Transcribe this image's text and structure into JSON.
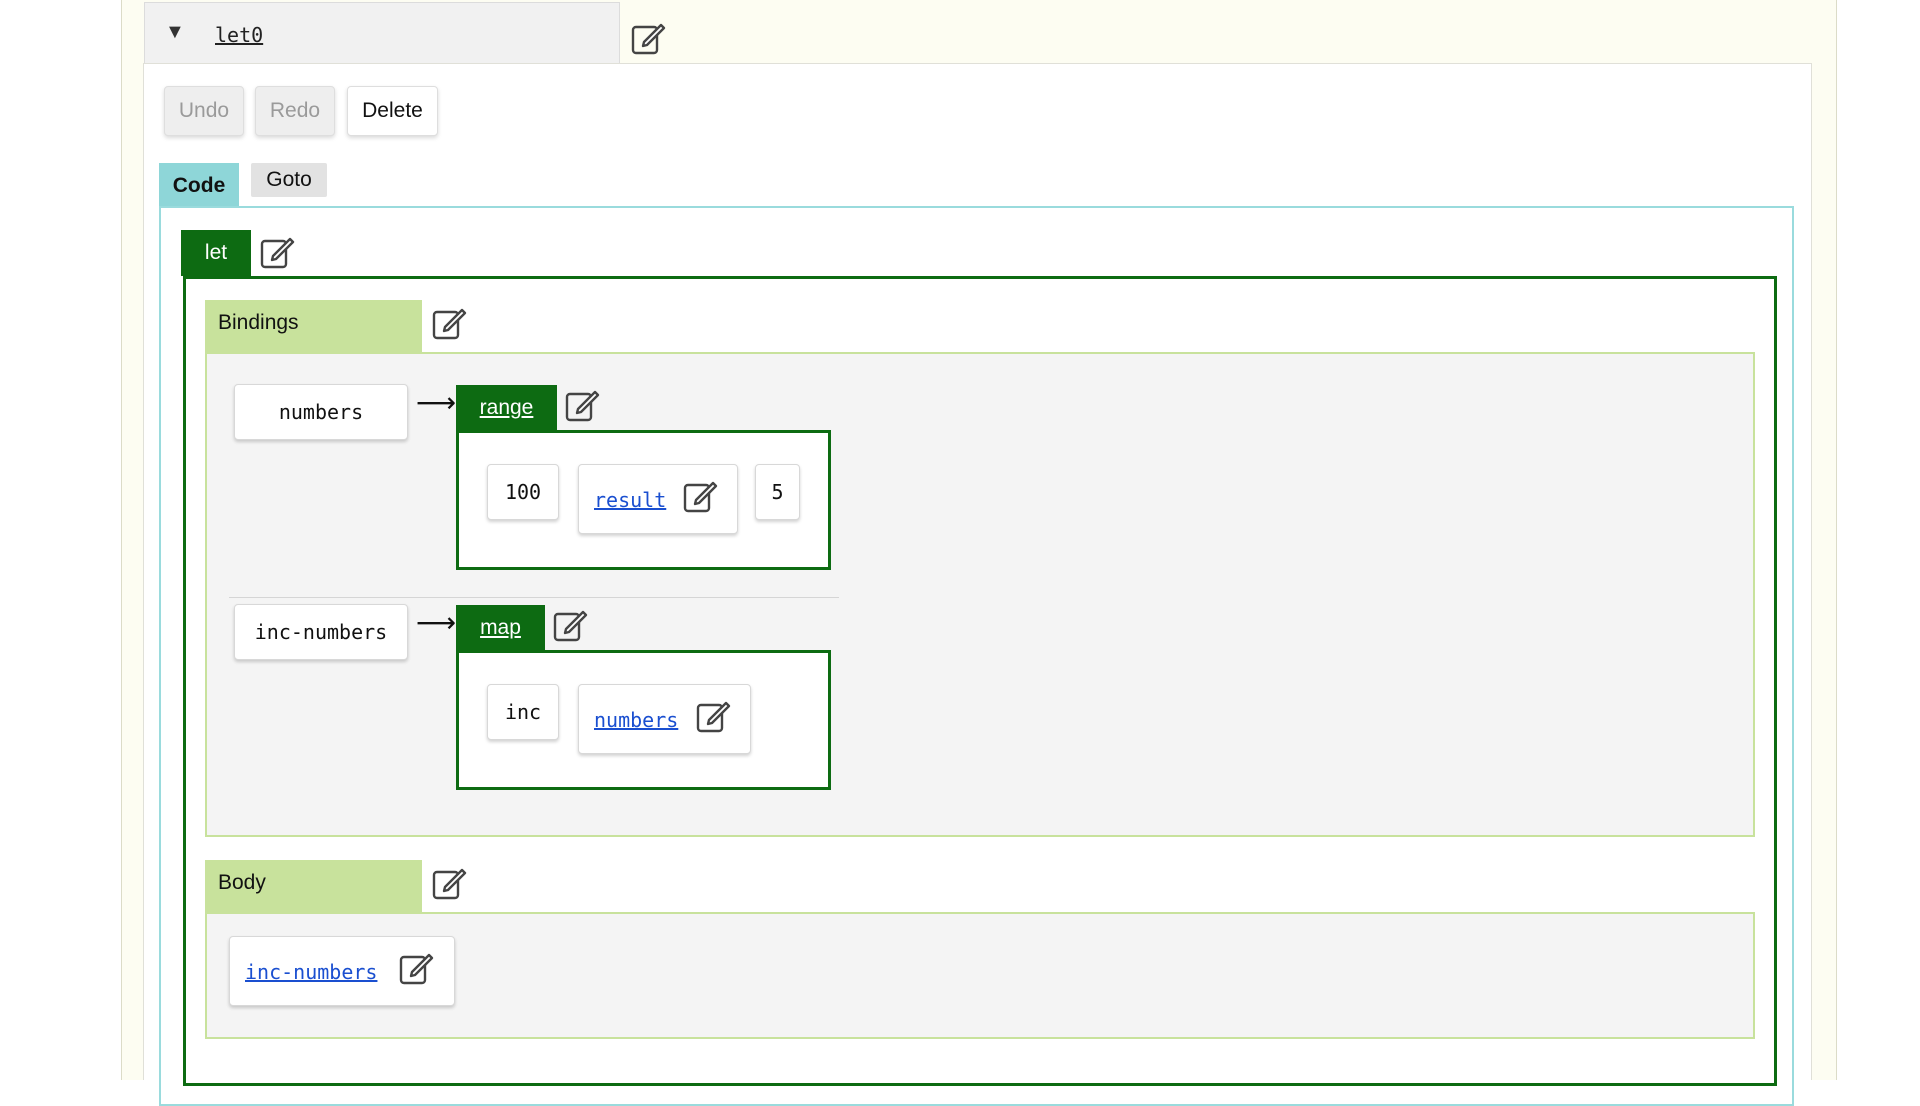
{
  "header": {
    "title": "let0"
  },
  "toolbar": {
    "undo_label": "Undo",
    "redo_label": "Redo",
    "delete_label": "Delete"
  },
  "tabs": {
    "code_label": "Code",
    "goto_label": "Goto"
  },
  "let_block": {
    "tag": "let",
    "bindings_label": "Bindings",
    "body_label": "Body",
    "bindings": [
      {
        "name": "numbers",
        "fn": "range",
        "args": [
          "100",
          "result",
          "5"
        ]
      },
      {
        "name": "inc-numbers",
        "fn": "map",
        "args": [
          "inc",
          "numbers"
        ]
      }
    ],
    "body_ref": "inc-numbers"
  },
  "arrow_glyph": "⟶",
  "collapse_glyph": "▼",
  "icons": {
    "edit": "edit-icon",
    "collapse": "triangle-down-icon"
  },
  "colors": {
    "let_green": "#0d6b12",
    "section_green": "#c8e29c",
    "tab_active": "#8ed6d8",
    "panel_cream": "#fdfdf2",
    "link_blue": "#1a4fd0"
  }
}
